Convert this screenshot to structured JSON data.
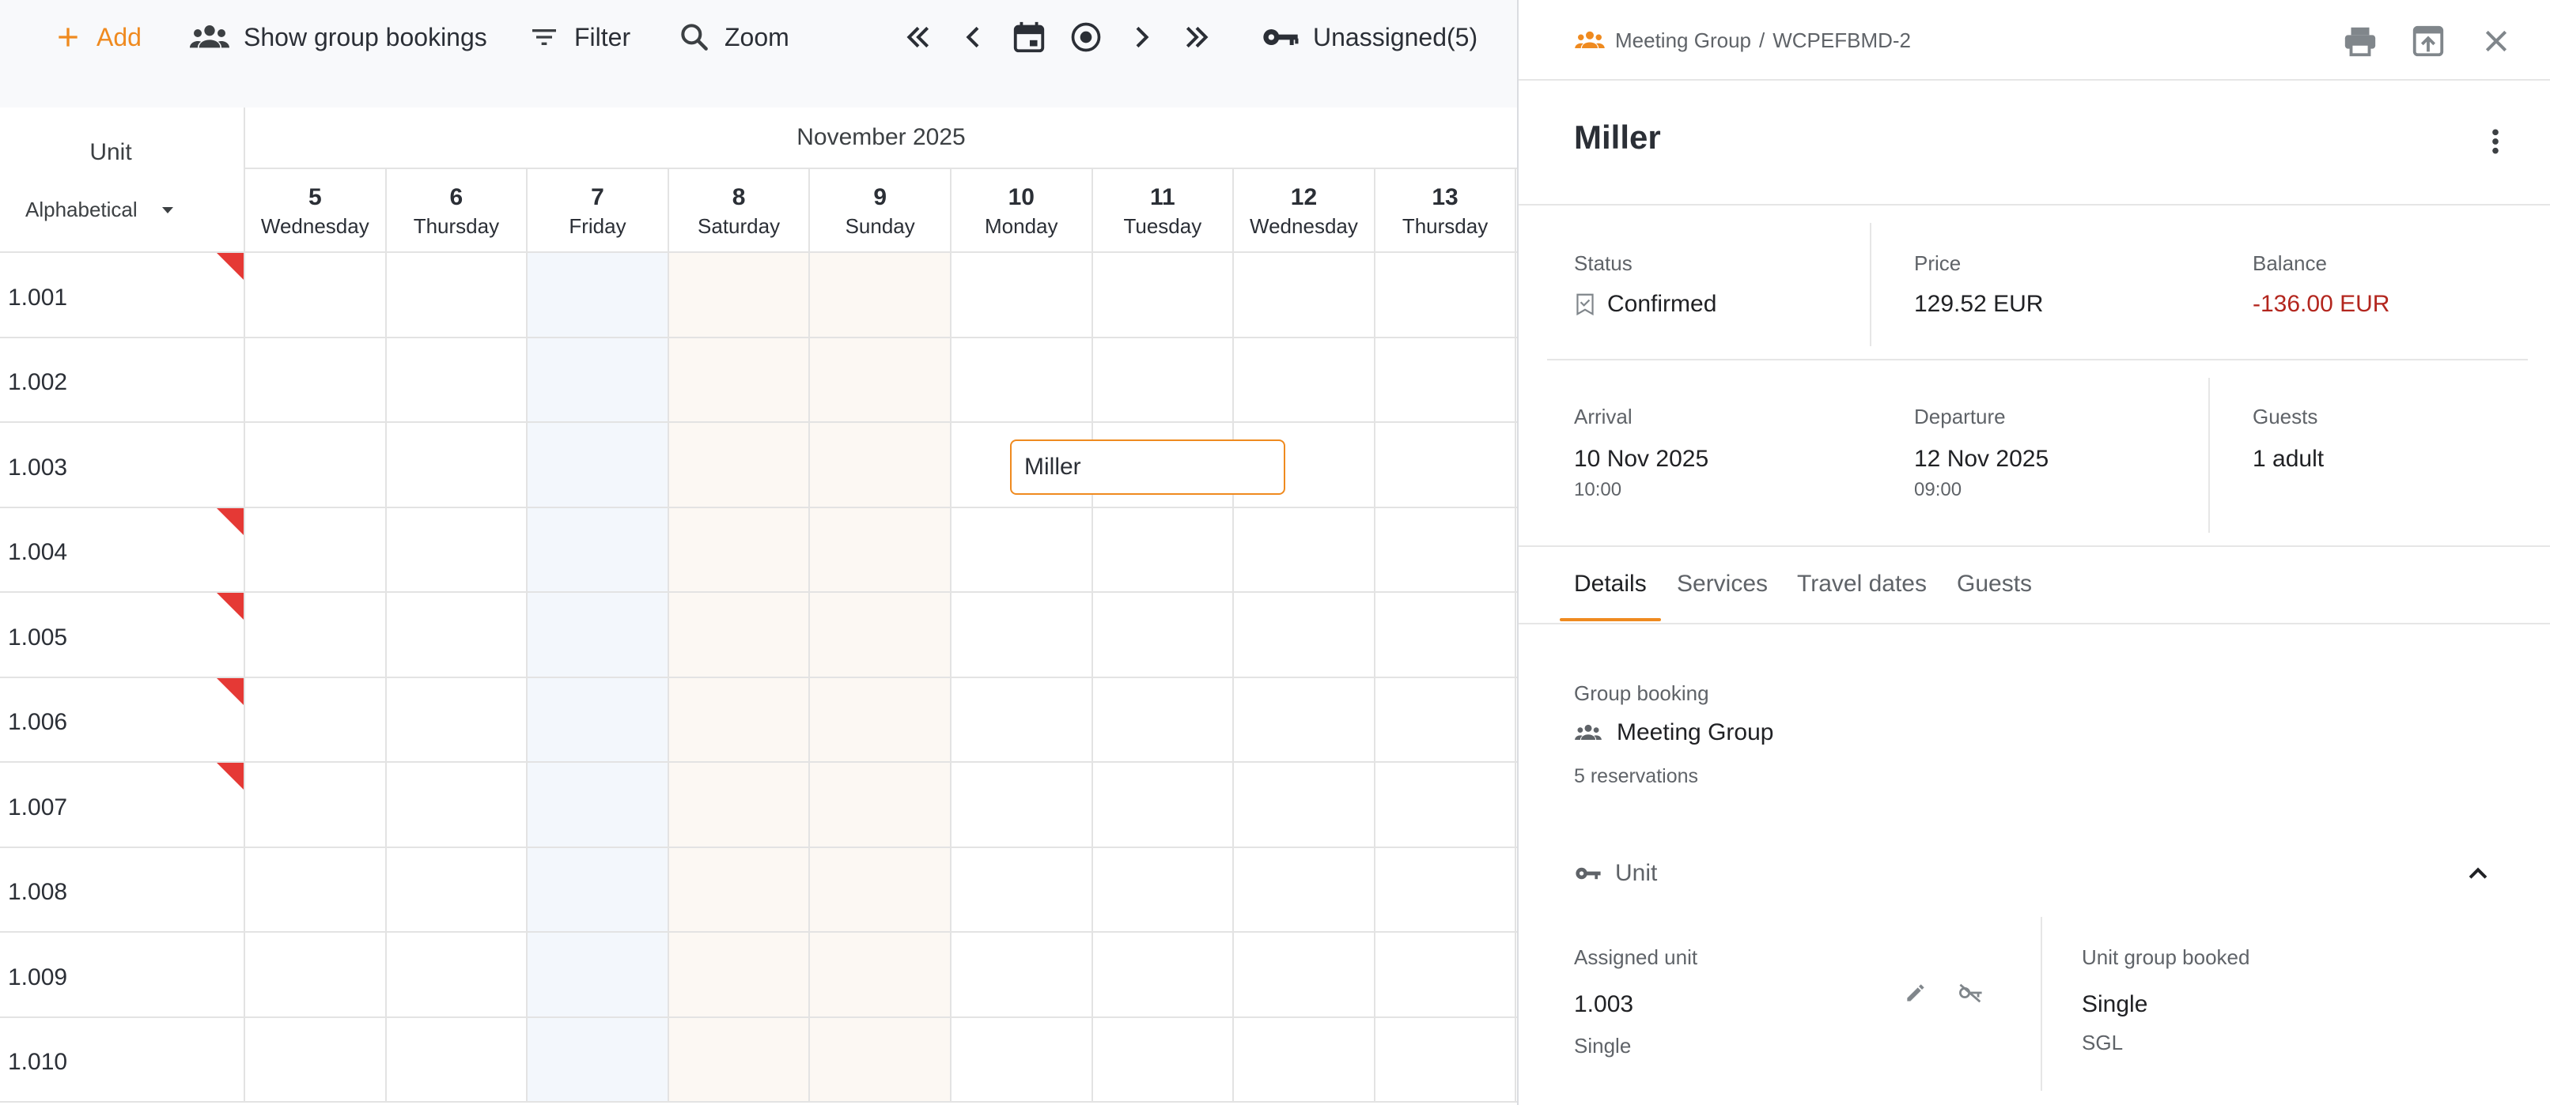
{
  "toolbar": {
    "add_label": "Add",
    "group_label": "Show group bookings",
    "filter_label": "Filter",
    "zoom_label": "Zoom",
    "unassigned_label": "Unassigned(5)"
  },
  "calendar": {
    "unit_header": "Unit",
    "sort_label": "Alphabetical",
    "month": "November 2025",
    "days": [
      {
        "num": "5",
        "name": "Wednesday"
      },
      {
        "num": "6",
        "name": "Thursday"
      },
      {
        "num": "7",
        "name": "Friday"
      },
      {
        "num": "8",
        "name": "Saturday"
      },
      {
        "num": "9",
        "name": "Sunday"
      },
      {
        "num": "10",
        "name": "Monday"
      },
      {
        "num": "11",
        "name": "Tuesday"
      },
      {
        "num": "12",
        "name": "Wednesday"
      },
      {
        "num": "13",
        "name": "Thursday"
      }
    ],
    "units": [
      "1.001",
      "1.002",
      "1.003",
      "1.004",
      "1.005",
      "1.006",
      "1.007",
      "1.008",
      "1.009",
      "1.010"
    ],
    "flagged_units": [
      "1.001",
      "1.004",
      "1.005",
      "1.006",
      "1.007"
    ],
    "booking_label": "Miller"
  },
  "panel": {
    "breadcrumb_group": "Meeting Group",
    "breadcrumb_sep": "/",
    "breadcrumb_id": "WCPEFBMD-2",
    "title": "Miller",
    "status_label": "Status",
    "status_value": "Confirmed",
    "price_label": "Price",
    "price_value": "129.52 EUR",
    "balance_label": "Balance",
    "balance_value": "-136.00 EUR",
    "arrival_label": "Arrival",
    "arrival_date": "10 Nov 2025",
    "arrival_time": "10:00",
    "departure_label": "Departure",
    "departure_date": "12 Nov 2025",
    "departure_time": "09:00",
    "guests_label": "Guests",
    "guests_value": "1 adult",
    "tabs": [
      "Details",
      "Services",
      "Travel dates",
      "Guests"
    ],
    "group_booking_label": "Group booking",
    "group_name": "Meeting Group",
    "group_count": "5 reservations",
    "unit_section": "Unit",
    "assigned_unit_label": "Assigned unit",
    "assigned_unit_value": "1.003",
    "assigned_unit_sub": "Single",
    "unit_group_label": "Unit group booked",
    "unit_group_value": "Single",
    "unit_group_code": "SGL"
  },
  "colors": {
    "accent": "#ef8a1f",
    "negative": "#b3261e",
    "flag": "#e53935"
  }
}
